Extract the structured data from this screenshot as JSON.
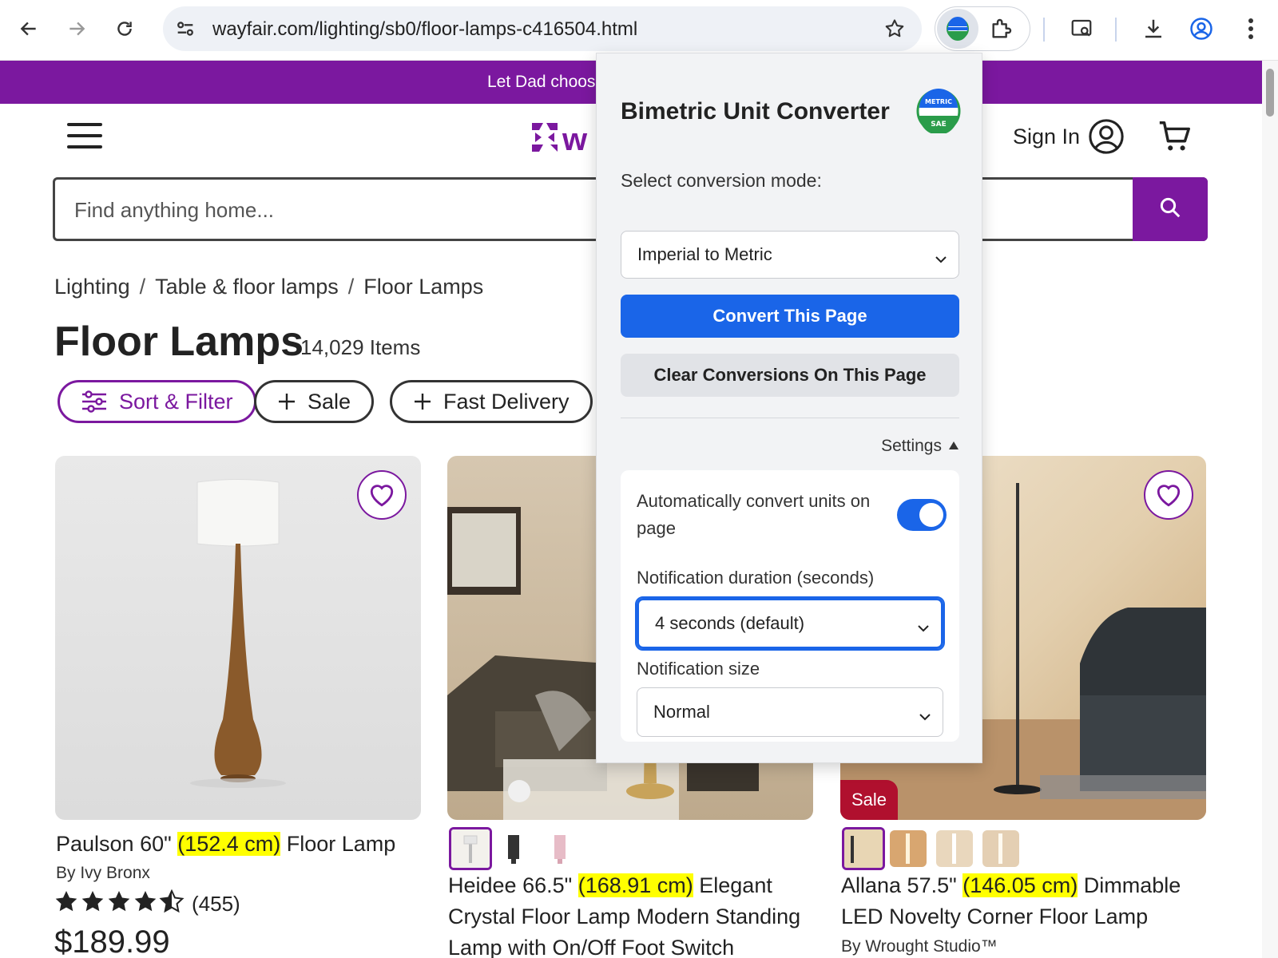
{
  "browser": {
    "url": "wayfair.com/lighting/sb0/floor-lamps-c416504.html"
  },
  "promo": {
    "text": "Let Dad choos"
  },
  "header": {
    "logo_text": "w",
    "signin_label": "Sign In",
    "search_placeholder": "Find anything home..."
  },
  "breadcrumb": {
    "items": [
      "Lighting",
      "Table & floor lamps",
      "Floor Lamps"
    ],
    "separator": "/"
  },
  "page": {
    "title": "Floor Lamps",
    "item_count": "14,029 Items"
  },
  "filters": {
    "sort_filter_label": "Sort & Filter",
    "sale_label": "Sale",
    "fast_delivery_label": "Fast Delivery"
  },
  "products": [
    {
      "title_pre": "Paulson 60\" ",
      "title_hl": "(152.4 cm)",
      "title_post": " Floor Lamp",
      "brand": "By Ivy Bronx",
      "rating": 4.5,
      "review_count": "(455)",
      "price": "$189.99"
    },
    {
      "title_line1_pre": "Heidee 66.5\" ",
      "title_hl": "(168.91 cm)",
      "title_line1_post": " Elegant",
      "title_line2": "Crystal Floor Lamp Modern Standing",
      "title_line3": "Lamp with On/Off Foot Switch"
    },
    {
      "sale_tag": "Sale",
      "title_line1_pre": "Allana 57.5\" ",
      "title_hl": "(146.05 cm)",
      "title_line1_post": " Dimmable",
      "title_line2": "LED Novelty Corner Floor Lamp",
      "brand": "By Wrought Studio™"
    }
  ],
  "popup": {
    "title": "Bimetric Unit Converter",
    "logo_top": "METRIC",
    "logo_bottom": "SAE",
    "mode_label": "Select conversion mode:",
    "mode_value": "Imperial to Metric",
    "convert_button": "Convert This Page",
    "clear_button": "Clear Conversions On This Page",
    "settings_label": "Settings",
    "auto_convert_label": "Automatically convert units on page",
    "auto_convert_enabled": true,
    "duration_label": "Notification duration (seconds)",
    "duration_value": "4 seconds (default)",
    "size_label": "Notification size",
    "size_value": "Normal"
  },
  "colors": {
    "brand_purple": "#7b189f",
    "primary_blue": "#1a65e8",
    "highlight": "#ffff00",
    "sale_red": "#b0102e"
  }
}
